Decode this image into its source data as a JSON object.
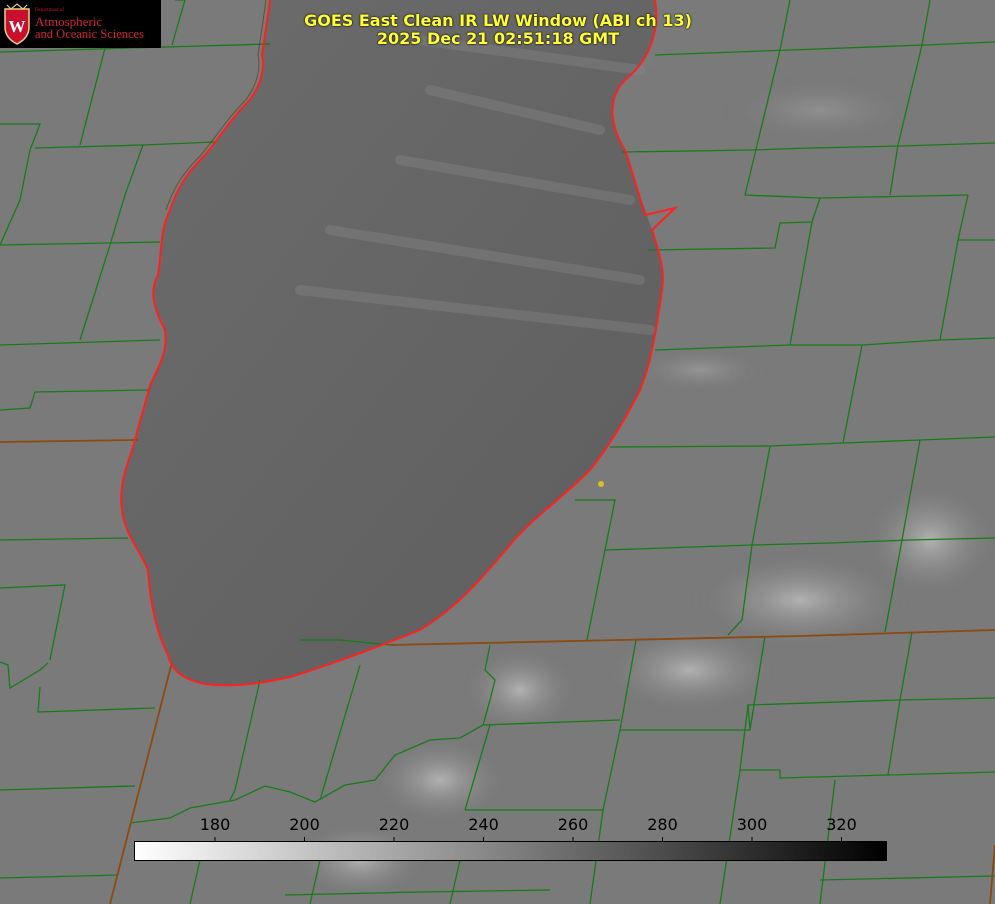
{
  "header": {
    "title_line1": "GOES East Clean IR LW Window (ABI ch 13)",
    "title_line2": "2025 Dec 21 02:51:18 GMT"
  },
  "logo": {
    "department": "Department of",
    "line1": "Atmospheric",
    "line2": "and Oceanic Sciences",
    "crest_letter": "W"
  },
  "colorbar": {
    "ticks": [
      "180",
      "200",
      "220",
      "240",
      "260",
      "280",
      "300",
      "320"
    ],
    "gradient_start_color": "#ffffff",
    "gradient_end_color": "#000000"
  },
  "colors": {
    "county_lines": "#1a7a1a",
    "state_lines": "#8a4a10",
    "lake_outline": "#ff2020",
    "title_text": "#ffff33",
    "logo_red": "#c8102e"
  }
}
